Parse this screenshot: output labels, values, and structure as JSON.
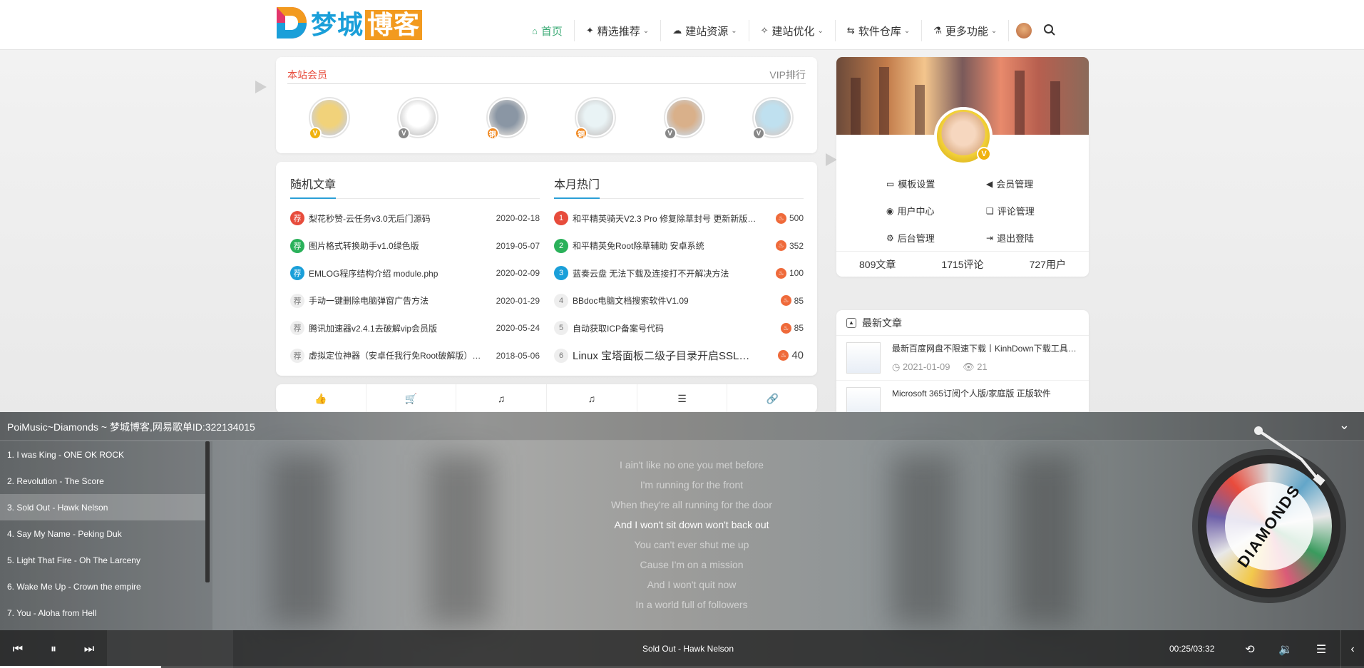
{
  "header": {
    "logo_text": "梦城",
    "logo_hl": "博客",
    "nav": [
      {
        "icon": "home-icon",
        "glyph": "⌂",
        "label": "首页",
        "active": true,
        "caret": false
      },
      {
        "icon": "crown-icon",
        "glyph": "✦",
        "label": "精选推荐",
        "caret": true
      },
      {
        "icon": "cloud-icon",
        "glyph": "☁",
        "label": "建站资源",
        "caret": true
      },
      {
        "icon": "optimize-icon",
        "glyph": "✧",
        "label": "建站优化",
        "caret": true
      },
      {
        "icon": "exchange-icon",
        "glyph": "⇆",
        "label": "软件仓库",
        "caret": true
      },
      {
        "icon": "flask-icon",
        "glyph": "⚗",
        "label": "更多功能",
        "caret": true
      }
    ]
  },
  "members": {
    "title": "本站会员",
    "ranking_link": "VIP排行",
    "list": [
      {
        "name": "member-1",
        "badge": "V",
        "badge_type": "gold",
        "color": "#f1d27a"
      },
      {
        "name": "member-2",
        "badge": "V",
        "badge_type": "gray",
        "color": "#ffffff"
      },
      {
        "name": "member-3",
        "badge": "铜",
        "badge_type": "orange",
        "color": "#8a96a4"
      },
      {
        "name": "member-4",
        "badge": "铜",
        "badge_type": "orange",
        "color": "#e9f3f5"
      },
      {
        "name": "member-5",
        "badge": "V",
        "badge_type": "gray",
        "color": "#d9b08a"
      },
      {
        "name": "member-6",
        "badge": "V",
        "badge_type": "gray",
        "color": "#bfe0ef"
      }
    ]
  },
  "random_articles": {
    "title": "随机文章",
    "items": [
      {
        "mark": "荐",
        "color": "#e74c3c",
        "title": "梨花秒赞-云任务v3.0无后门源码",
        "date": "2020-02-18"
      },
      {
        "mark": "荐",
        "color": "#2ab15a",
        "title": "图片格式转换助手v1.0绿色版",
        "date": "2019-05-07"
      },
      {
        "mark": "荐",
        "color": "#1a9fd9",
        "title": "EMLOG程序结构介绍 module.php",
        "date": "2020-02-09"
      },
      {
        "mark": "荐",
        "color": "#eeeeee",
        "title": "手动一键删除电脑弹窗广告方法",
        "date": "2020-01-29"
      },
      {
        "mark": "荐",
        "color": "#eeeeee",
        "title": "腾讯加速器v2.4.1去破解vip会员版",
        "date": "2020-05-24"
      },
      {
        "mark": "荐",
        "color": "#eeeeee",
        "title": "虚拟定位神器（安卓任我行免Root破解版）…",
        "date": "2018-05-06"
      }
    ]
  },
  "hot_articles": {
    "title": "本月热门",
    "items": [
      {
        "num": "1",
        "color": "#e74c3c",
        "title": "和平精英骑天V2.3 Pro 修复除草封号 更新新版…",
        "hits": "500"
      },
      {
        "num": "2",
        "color": "#2ab15a",
        "title": "和平精英免Root除草辅助 安卓系统",
        "hits": "352"
      },
      {
        "num": "3",
        "color": "#1a9fd9",
        "title": "蓝奏云盘 无法下载及连接打不开解决方法",
        "hits": "100"
      },
      {
        "num": "4",
        "color": "#eeeeee",
        "title": "BBdoc电脑文档搜索软件V1.09",
        "hits": "85"
      },
      {
        "num": "5",
        "color": "#eeeeee",
        "title": "自动获取ICP备案号代码",
        "hits": "85"
      },
      {
        "num": "6",
        "color": "#eeeeee",
        "title": "Linux 宝塔面板二级子目录开启SSL证书",
        "hits": "40"
      }
    ]
  },
  "tab_icons": [
    {
      "name": "thumbs-up-icon",
      "glyph": "👍"
    },
    {
      "name": "cart-icon",
      "glyph": "🛒"
    },
    {
      "name": "music-icon",
      "glyph": "♫"
    },
    {
      "name": "music-icon-2",
      "glyph": "♫"
    },
    {
      "name": "list-icon",
      "glyph": "☰"
    },
    {
      "name": "link-icon",
      "glyph": "🔗"
    }
  ],
  "profile": {
    "menu": [
      {
        "icon": "monitor-icon",
        "glyph": "▭",
        "label": "模板设置"
      },
      {
        "icon": "bullhorn-icon",
        "glyph": "◀",
        "label": "会员管理"
      },
      {
        "icon": "user-circle-icon",
        "glyph": "◉",
        "label": "用户中心"
      },
      {
        "icon": "comments-icon",
        "glyph": "❏",
        "label": "评论管理"
      },
      {
        "icon": "cogs-icon",
        "glyph": "⚙",
        "label": "后台管理"
      },
      {
        "icon": "sign-out-icon",
        "glyph": "⇥",
        "label": "退出登陆"
      }
    ],
    "stats": [
      "809文章",
      "1715评论",
      "727用户"
    ]
  },
  "latest": {
    "title": "最新文章",
    "items": [
      {
        "title": "最新百度网盘不限速下载丨KinhDown下载工具…",
        "date": "2021-01-09",
        "views": "21"
      },
      {
        "title": "Microsoft 365订阅个人版/家庭版 正版软件",
        "date": "",
        "views": ""
      }
    ]
  },
  "player": {
    "header": "PoiMusic~Diamonds ~ 梦城博客,网易歌单ID:322134015",
    "playlist": [
      "1. I was King - ONE OK ROCK",
      "2. Revolution - The Score",
      "3. Sold Out - Hawk Nelson",
      "4. Say My Name - Peking Duk",
      "5. Light That Fire - Oh The Larceny",
      "6. Wake Me Up - Crown the empire",
      "7. You - Aloha from Hell"
    ],
    "current_index": 2,
    "lyrics": [
      "I ain't like no one you met before",
      "I'm running for the front",
      "When they're all running for the door",
      "And I won't sit down won't back out",
      "You can't ever shut me up",
      "Cause I'm on a mission",
      "And I won't quit now",
      "In a world full of followers"
    ],
    "current_lyric": 3,
    "disc_label": "DIAMONDS",
    "now_playing": "Sold Out - Hawk Nelson",
    "time": "00:25/03:32",
    "progress": 0.118
  }
}
